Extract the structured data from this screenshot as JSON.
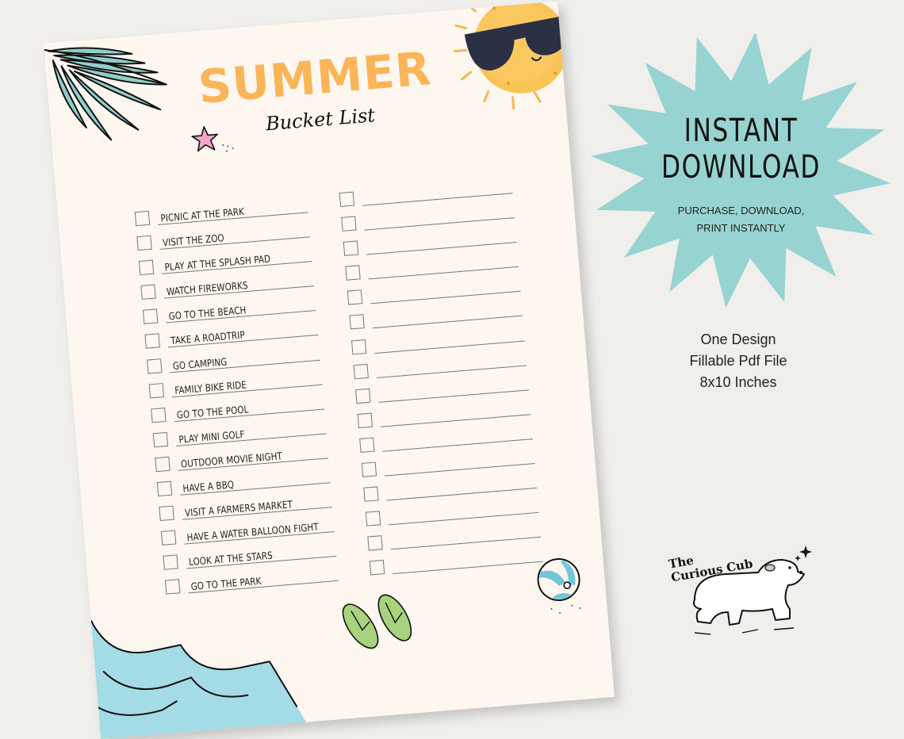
{
  "document": {
    "title": "SUMMER",
    "subtitle": "Bucket List",
    "checklist_left": [
      "PICNIC AT THE PARK",
      "VISIT THE ZOO",
      "PLAY AT THE SPLASH PAD",
      "WATCH FIREWORKS",
      "GO TO THE BEACH",
      "TAKE A ROADTRIP",
      "GO CAMPING",
      "FAMILY BIKE RIDE",
      "GO TO THE POOL",
      "PLAY MINI GOLF",
      "OUTDOOR MOVIE NIGHT",
      "HAVE A BBQ",
      "VISIT A FARMERS MARKET",
      "HAVE A WATER BALLOON FIGHT",
      "LOOK AT THE STARS",
      "GO TO THE PARK"
    ],
    "checklist_right_blank_count": 16,
    "decorations": [
      "palm-leaf-icon",
      "sun-with-sunglasses-icon",
      "starfish-icon",
      "ocean-waves-icon",
      "flip-flops-icon",
      "beach-ball-icon"
    ],
    "colors": {
      "title": "#FBB559",
      "paper": "#FDF7F0",
      "accent_teal": "#8FCFCB",
      "wave_blue": "#A3DBE6",
      "flipflop_green": "#A9D27E"
    }
  },
  "promo": {
    "badge_line1": "INSTANT",
    "badge_line2": "DOWNLOAD",
    "badge_sub1": "PURCHASE, DOWNLOAD,",
    "badge_sub2": "PRINT INSTANTLY",
    "badge_color": "#97D4D1",
    "info": [
      "One Design",
      "Fillable Pdf File",
      "8x10 Inches"
    ]
  },
  "brand": {
    "line1": "The",
    "line2": "Curious Cub",
    "icon": "polar-bear-cub-icon"
  },
  "background_color": "#F0EFEC"
}
